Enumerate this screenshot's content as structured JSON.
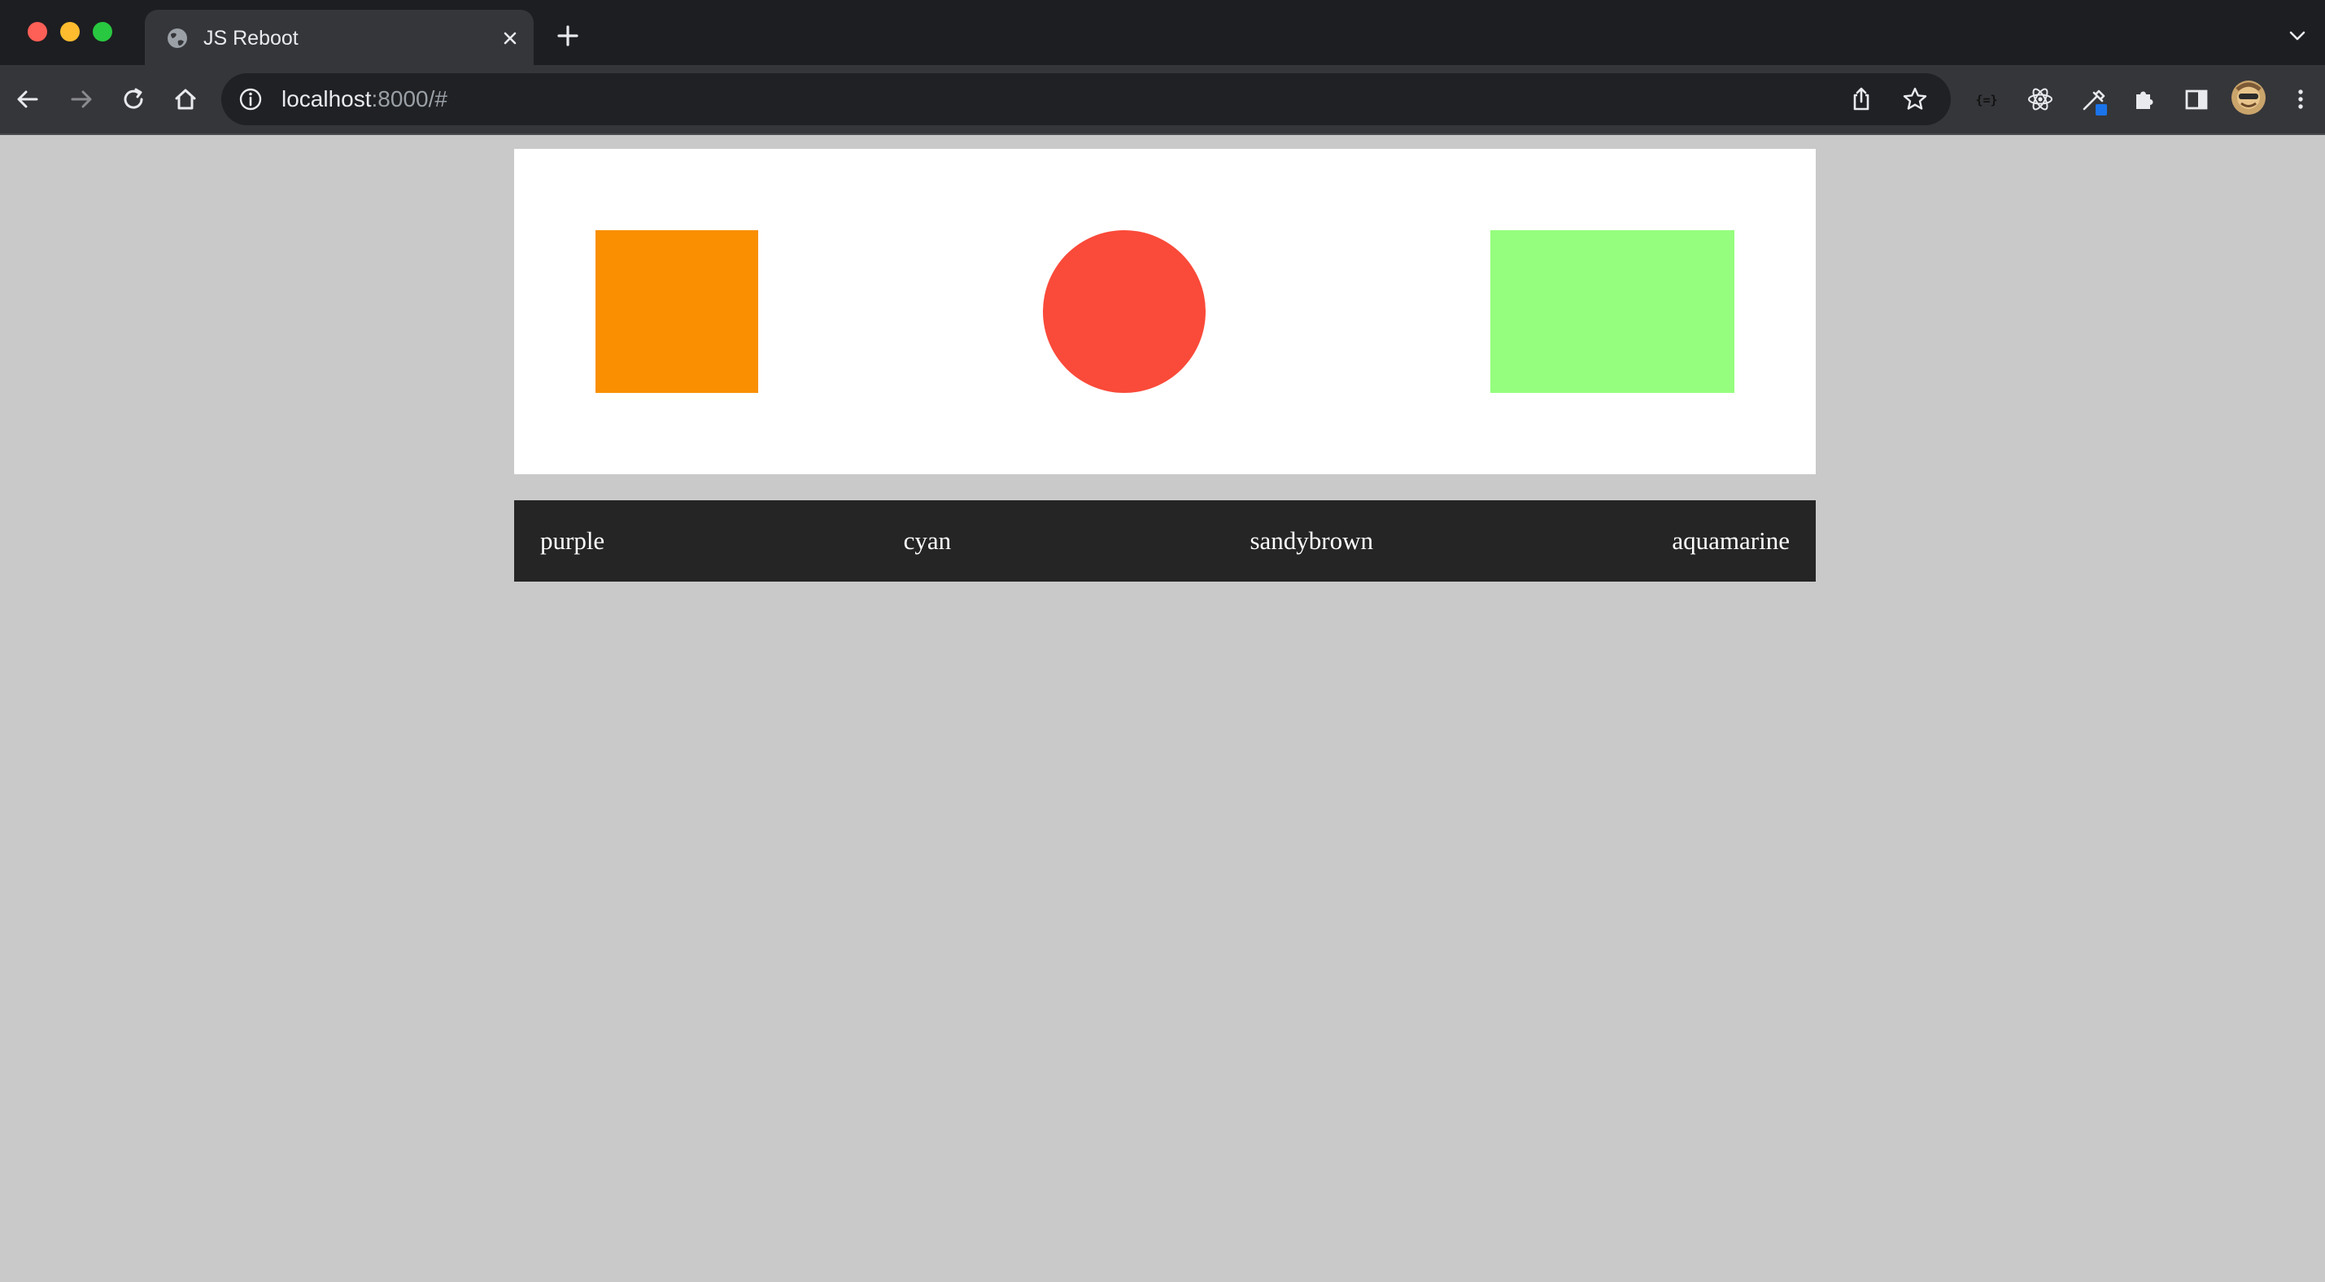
{
  "browser": {
    "tab": {
      "title": "JS Reboot"
    },
    "omnibox": {
      "host": "localhost",
      "rest": ":8000/#"
    }
  },
  "page": {
    "shapes": [
      {
        "kind": "square",
        "color": "#f98f01"
      },
      {
        "kind": "circle",
        "color": "#fa4a39"
      },
      {
        "kind": "rectangle",
        "color": "#95fe7e"
      }
    ],
    "color_options": [
      "purple",
      "cyan",
      "sandybrown",
      "aquamarine"
    ]
  }
}
